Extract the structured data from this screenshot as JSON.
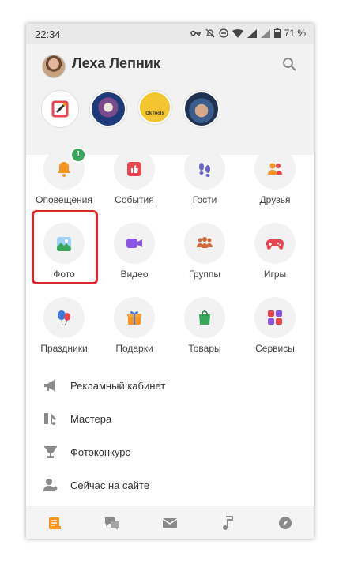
{
  "status_bar": {
    "time": "22:34",
    "battery": "71 %"
  },
  "profile": {
    "name": "Леха Лепник"
  },
  "stories": {
    "third_text": "OkTools"
  },
  "notifications_badge": "1",
  "tiles": [
    {
      "label": "Оповещения",
      "icon": "bell-icon",
      "color": "#f7931e"
    },
    {
      "label": "События",
      "icon": "like-icon",
      "color": "#e8454f"
    },
    {
      "label": "Гости",
      "icon": "footprints-icon",
      "color": "#6b63c4"
    },
    {
      "label": "Друзья",
      "icon": "friends-icon",
      "color": "#f7931e"
    },
    {
      "label": "Фото",
      "icon": "photo-icon",
      "color": "#3aa7e0"
    },
    {
      "label": "Видео",
      "icon": "video-icon",
      "color": "#8a55e5"
    },
    {
      "label": "Группы",
      "icon": "groups-icon",
      "color": "#d06a3a"
    },
    {
      "label": "Игры",
      "icon": "gamepad-icon",
      "color": "#e8454f"
    },
    {
      "label": "Праздники",
      "icon": "balloons-icon",
      "color": "#3a7be0"
    },
    {
      "label": "Подарки",
      "icon": "gift-icon",
      "color": "#f7931e"
    },
    {
      "label": "Товары",
      "icon": "shopping-bag-icon",
      "color": "#3aa55c"
    },
    {
      "label": "Сервисы",
      "icon": "services-icon",
      "color": "#e8454f"
    }
  ],
  "menu": [
    {
      "label": "Рекламный кабинет",
      "icon": "megaphone-icon"
    },
    {
      "label": "Мастера",
      "icon": "tools-icon"
    },
    {
      "label": "Фотоконкурс",
      "icon": "trophy-icon"
    },
    {
      "label": "Сейчас на сайте",
      "icon": "online-users-icon"
    }
  ],
  "bottom_nav": [
    {
      "icon": "feed-icon",
      "active": true,
      "color": "#f7931e"
    },
    {
      "icon": "chat-icon",
      "active": false,
      "color": "#8a8a8a"
    },
    {
      "icon": "mail-icon",
      "active": false,
      "color": "#8a8a8a"
    },
    {
      "icon": "music-icon",
      "active": false,
      "color": "#8a8a8a"
    },
    {
      "icon": "compass-icon",
      "active": false,
      "color": "#8a8a8a"
    }
  ]
}
